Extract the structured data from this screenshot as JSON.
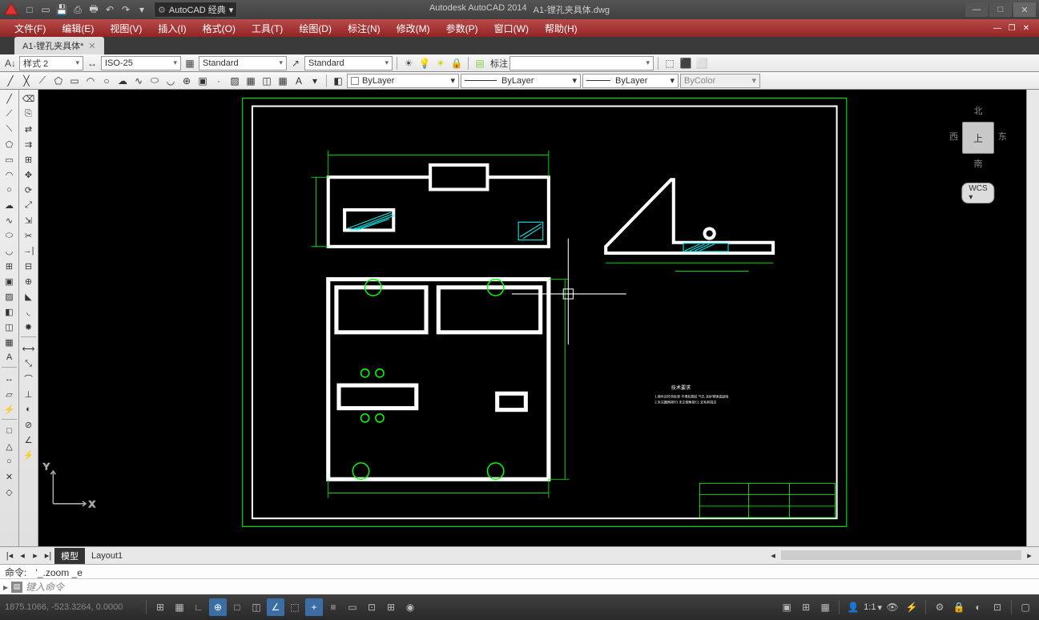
{
  "title": {
    "app": "Autodesk AutoCAD 2014",
    "file": "A1-镗孔夹具体.dwg"
  },
  "workspace": {
    "label": "AutoCAD 经典"
  },
  "menus": [
    {
      "label": "文件(F)"
    },
    {
      "label": "编辑(E)"
    },
    {
      "label": "视图(V)"
    },
    {
      "label": "插入(I)"
    },
    {
      "label": "格式(O)"
    },
    {
      "label": "工具(T)"
    },
    {
      "label": "绘图(D)"
    },
    {
      "label": "标注(N)"
    },
    {
      "label": "修改(M)"
    },
    {
      "label": "参数(P)"
    },
    {
      "label": "窗口(W)"
    },
    {
      "label": "帮助(H)"
    }
  ],
  "doc_tab": "A1-镗孔夹具体*",
  "style_bar": {
    "text_style": "样式 2",
    "dim_style": "ISO-25",
    "table_style": "Standard",
    "mleader_style": "Standard",
    "annotative_label": "标注"
  },
  "layer_bar": {
    "layer": "ByLayer",
    "linetype": "ByLayer",
    "lineweight": "ByLayer",
    "color": "ByColor"
  },
  "viewcube": {
    "top": "上",
    "n": "北",
    "s": "南",
    "e": "东",
    "w": "西",
    "wcs": "WCS"
  },
  "layout_tabs": {
    "model": "模型",
    "layout1": "Layout1"
  },
  "command": {
    "label": "命令:",
    "last": "'_.zoom _e",
    "placeholder": "键入命令"
  },
  "status": {
    "coords": "1875.1066, -523.3264, 0.0000",
    "scale": "1:1"
  },
  "draw_tools": [
    "line",
    "poly",
    "circle",
    "arc",
    "rect",
    "hatch",
    "text",
    "table",
    "dim"
  ],
  "modify_tools": [
    "erase",
    "copy",
    "mirror",
    "offset",
    "array",
    "move",
    "rotate",
    "scale",
    "stretch",
    "trim",
    "extend",
    "fillet",
    "chamfer",
    "explode"
  ]
}
